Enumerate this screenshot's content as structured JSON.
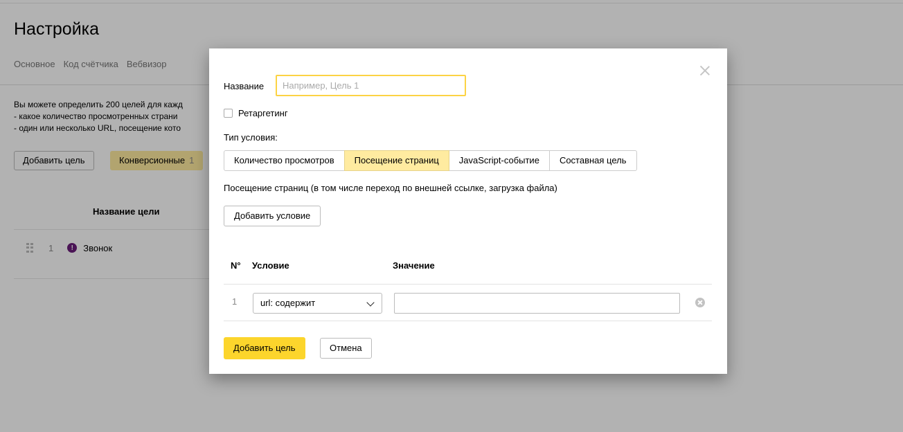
{
  "page": {
    "title": "Настройка",
    "tabs": [
      "Основное",
      "Код счётчика",
      "Вебвизор"
    ],
    "description_lines": [
      "Вы можете определить 200 целей для кажд",
      "- какое количество просмотренных страни",
      "- один или несколько URL, посещение кото"
    ],
    "add_goal_label": "Добавить цель",
    "conversion_label": "Конверсионные",
    "conversion_count": "1",
    "column_goal_name": "Название цели",
    "goals": [
      {
        "num": "1",
        "name": "Звонок",
        "status_icon_glyph": "!"
      }
    ]
  },
  "modal": {
    "name_label": "Название",
    "name_placeholder": "Например, Цель 1",
    "name_value": "",
    "retargeting_label": "Ретаргетинг",
    "retargeting_checked": false,
    "condition_type_label": "Тип условия:",
    "condition_tabs": [
      {
        "label": "Количество просмотров",
        "active": false
      },
      {
        "label": "Посещение страниц",
        "active": true
      },
      {
        "label": "JavaScript-событие",
        "active": false
      },
      {
        "label": "Составная цель",
        "active": false
      }
    ],
    "condition_description": "Посещение страниц (в том числе переход по внешней ссылке, загрузка файла)",
    "add_condition_label": "Добавить условие",
    "table": {
      "col_num": "N°",
      "col_condition": "Условие",
      "col_value": "Значение",
      "rows": [
        {
          "num": "1",
          "condition": "url: содержит",
          "value": ""
        }
      ]
    },
    "submit_label": "Добавить цель",
    "cancel_label": "Отмена"
  },
  "colors": {
    "accent_yellow": "#fcd52c",
    "active_tab": "#ffeba0",
    "input_focus_border": "#fcd344",
    "status_icon": "#6a1d7a",
    "overlay": "rgba(0,0,0,0.30)"
  }
}
